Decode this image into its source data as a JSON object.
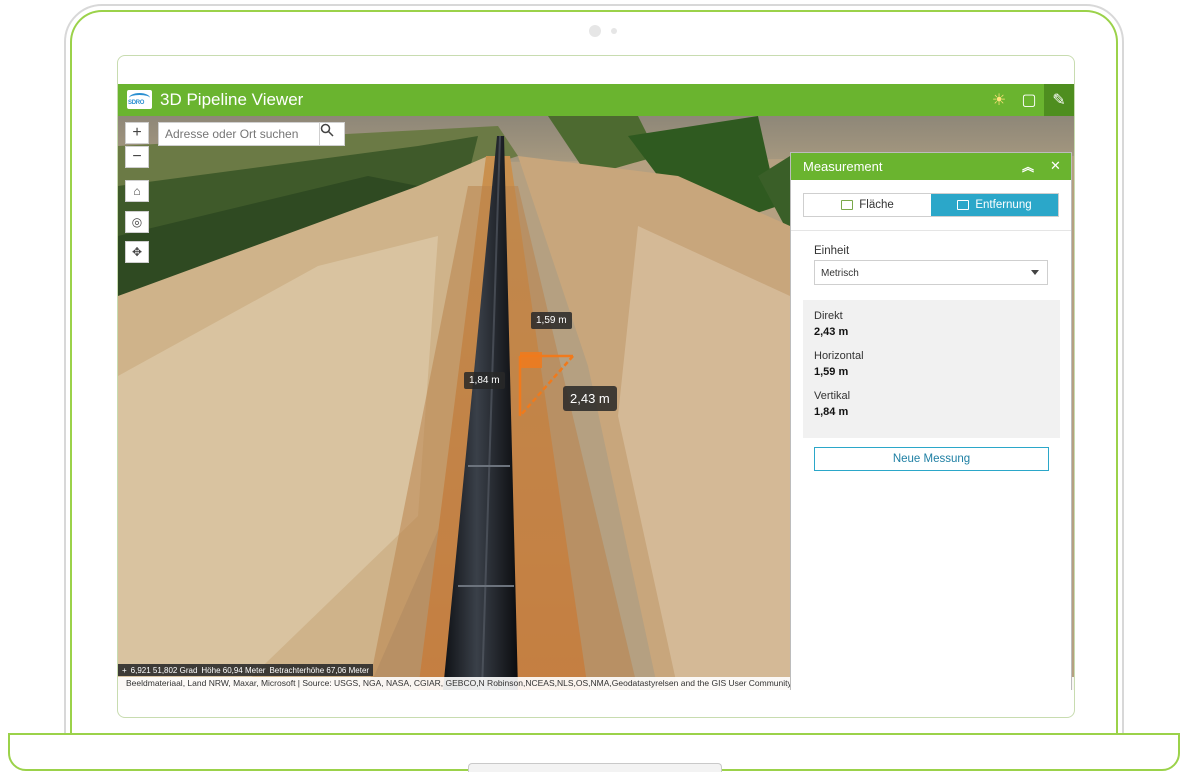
{
  "app": {
    "title": "3D Pipeline Viewer",
    "logo_text": "SDRO"
  },
  "toolbar": {
    "sun_icon": "sun-icon",
    "screen_icon": "screen-icon",
    "measure_icon": "ruler-icon"
  },
  "search": {
    "placeholder": "Adresse oder Ort suchen"
  },
  "map_controls": {
    "zoom_in": "+",
    "zoom_out": "−"
  },
  "measure_labels": {
    "horizontal": "1,59 m",
    "vertical": "1,84 m",
    "direct": "2,43 m"
  },
  "statusbar": {
    "icon": "+",
    "coords": "6,921 51,802 Grad",
    "height": "Höhe 60,94 Meter",
    "viewer_height": "Betrachterhöhe 67,06 Meter"
  },
  "attribution": "Beeldmateriaal, Land NRW, Maxar, Microsoft | Source: USGS, NGA, NASA, CGIAR, GEBCO,N Robinson,NCEAS,NLS,OS,NMA,Geodatastyrelsen and the GIS User Community | Geodaten NRW (Geobasis) · Powered by Esri",
  "panel": {
    "title": "Measurement",
    "tabs": [
      {
        "label": "Fläche",
        "active": false
      },
      {
        "label": "Entfernung",
        "active": true
      }
    ],
    "unit_label": "Einheit",
    "unit_value": "Metrisch",
    "results": [
      {
        "label": "Direkt",
        "value": "2,43 m"
      },
      {
        "label": "Horizontal",
        "value": "1,59 m"
      },
      {
        "label": "Vertikal",
        "value": "1,84 m"
      }
    ],
    "new_button": "Neue Messung"
  },
  "colors": {
    "brand_green": "#6ab42f",
    "accent_blue": "#2ba7c9",
    "measure_orange": "#f07a1c"
  }
}
